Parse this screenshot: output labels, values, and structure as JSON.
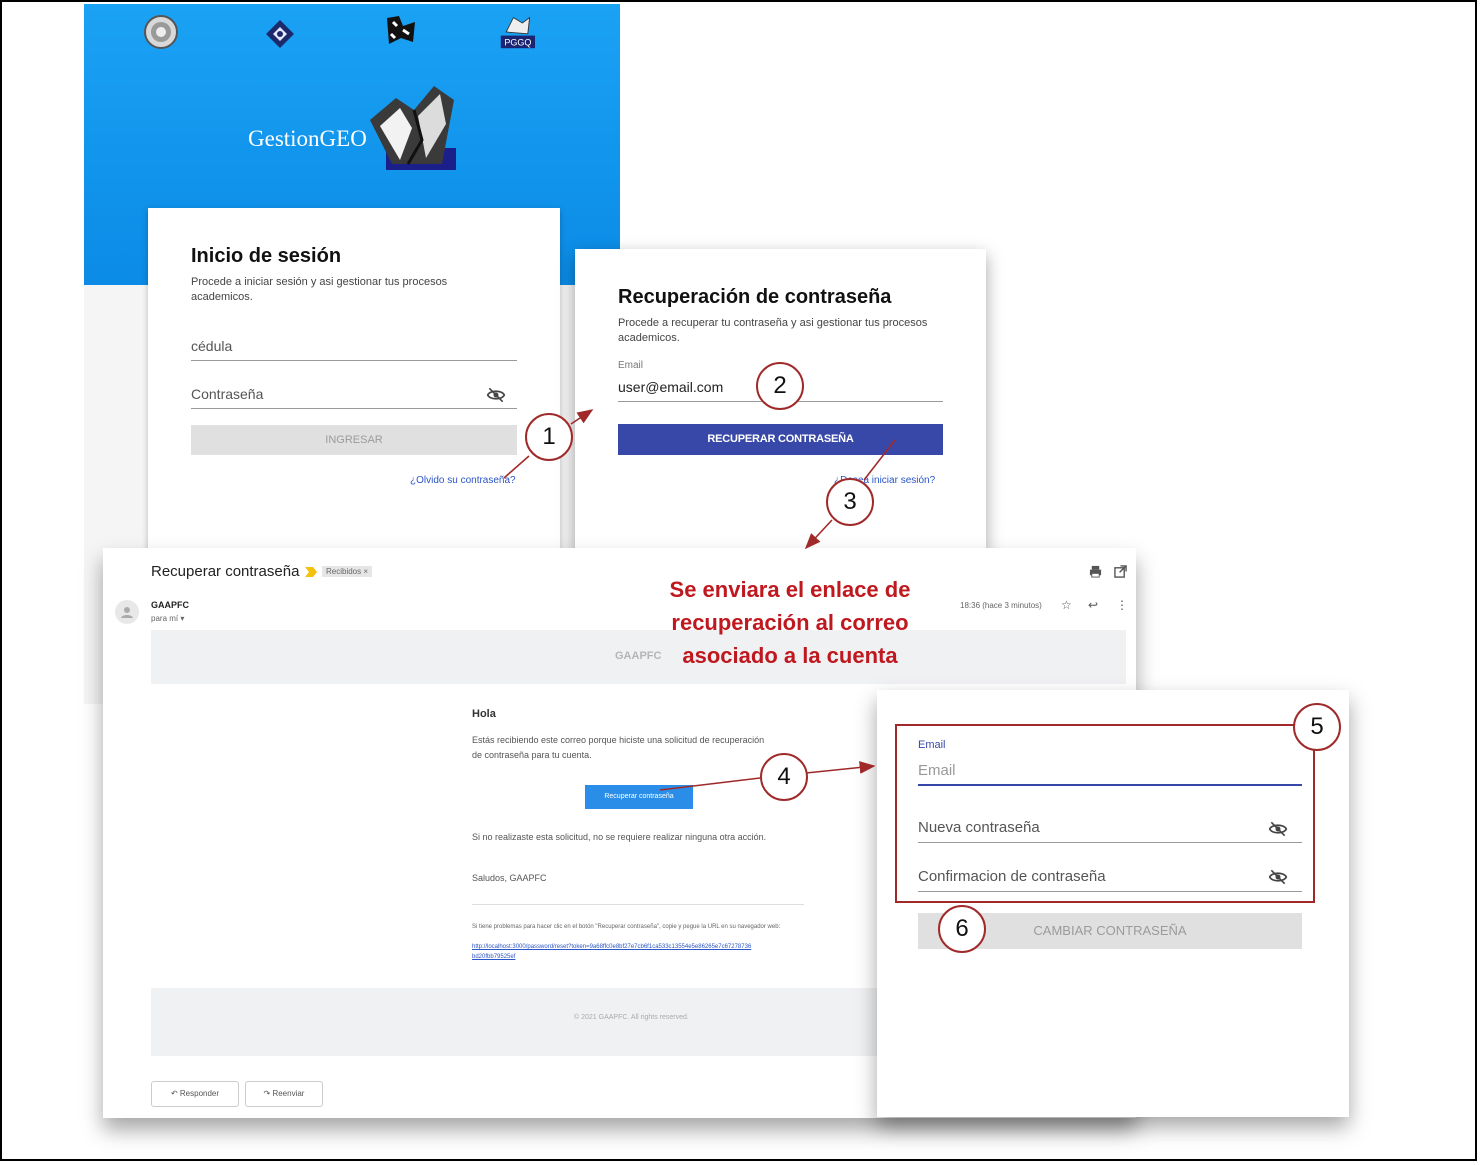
{
  "login": {
    "brand": "GestionGEO",
    "title": "Inicio de sesión",
    "subtitle": "Procede a iniciar sesión y asi gestionar tus procesos academicos.",
    "cedula_placeholder": "cédula",
    "password_placeholder": "Contraseña",
    "submit_label": "INGRESAR",
    "forgot_link": "¿Olvido su contraseña?"
  },
  "recovery": {
    "title": "Recuperación de contraseña",
    "subtitle": "Procede a recuperar tu contraseña y asi gestionar tus procesos academicos.",
    "email_label": "Email",
    "email_value": "user@email.com",
    "submit_label": "RECUPERAR CONTRASEÑA",
    "back_link": "¿Desea iniciar sesión?"
  },
  "email": {
    "subject": "Recuperar contraseña",
    "folder_badge": "Recibidos ×",
    "sender": "GAAPFC",
    "to": "para mí ▾",
    "time": "18:36 (hace 3 minutos)",
    "header_brand": "GAAPFC",
    "greeting": "Hola",
    "body1": "Estás recibiendo este correo porque hiciste una solicitud de recuperación de contraseña para tu cuenta.",
    "button": "Recuperar contraseña",
    "body2": "Si no realizaste esta solicitud, no se requiere realizar ninguna otra acción.",
    "signoff": "Saludos, GAAPFC",
    "trouble_text": "Si tiene problemas para hacer clic en el botón \"Recuperar contraseña\", copie y pegue la URL en su navegador web:",
    "trouble_link": "http://localhost:3000/password/reset?token=9a68ffc0e8bf27e7cb6f1ca533c13554e5e86265e7c67278736bd20fbb79525ef",
    "footer": "© 2021 GAAPFC. All rights reserved.",
    "reply": "Responder",
    "forward": "Reenviar"
  },
  "reset": {
    "email_label": "Email",
    "email_placeholder": "Email",
    "new_password": "Nueva contraseña",
    "confirm_password": "Confirmacion de contraseña",
    "submit_label": "CAMBIAR CONTRASEÑA"
  },
  "annotations": {
    "note": "Se enviara el enlace de recuperación al correo asociado a la cuenta",
    "steps": [
      "1",
      "2",
      "3",
      "4",
      "5",
      "6"
    ]
  },
  "colors": {
    "annotation": "#a02a2a",
    "note": "#c0181f",
    "primary": "#3848a8",
    "email_button": "#2a8ee8"
  }
}
